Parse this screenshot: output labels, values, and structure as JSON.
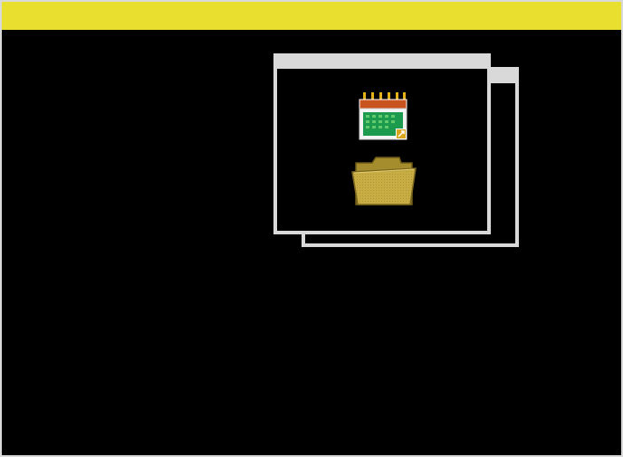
{
  "screen": {
    "background_color": "#000000",
    "topbar_color": "#e9df2f",
    "window_frame_color": "#d9d9d9"
  },
  "windows": [
    {
      "id": "back-window",
      "title": ""
    },
    {
      "id": "front-window",
      "title": ""
    }
  ],
  "icons": [
    {
      "name": "calendar-icon",
      "label": ""
    },
    {
      "name": "folder-icon",
      "label": ""
    }
  ]
}
